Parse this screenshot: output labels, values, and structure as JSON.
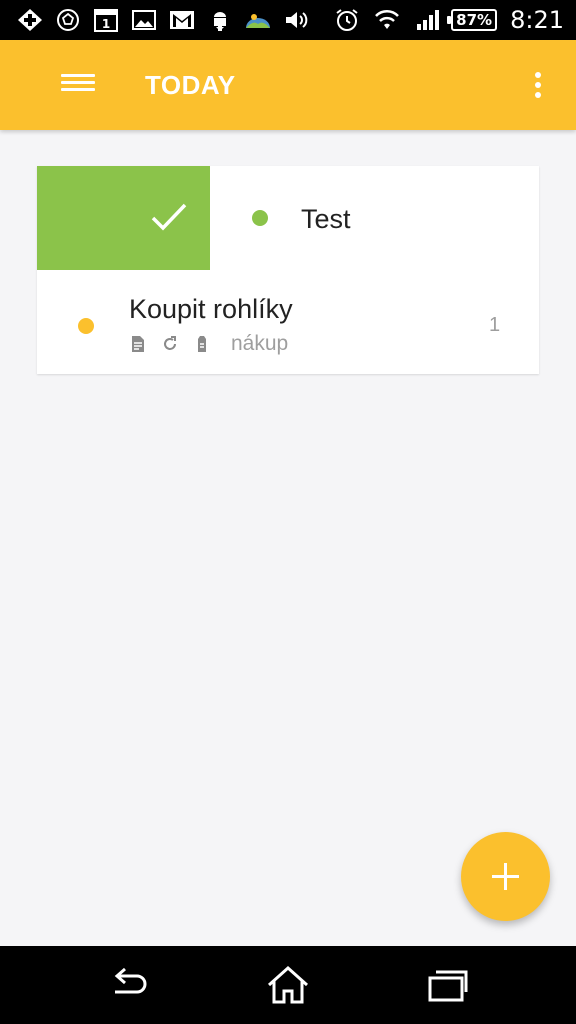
{
  "status_bar": {
    "notification_icons": [
      "plus-app-icon",
      "soccer-ball-icon",
      "calendar-icon",
      "gallery-icon",
      "gmail-icon",
      "android-icon",
      "landscape-icon",
      "volume-icon"
    ],
    "calendar_day": "1",
    "system_icons": [
      "alarm-icon",
      "wifi-icon",
      "signal-icon",
      "battery-icon"
    ],
    "battery": "87%",
    "time": "8:21"
  },
  "app_bar": {
    "title": "TODAY",
    "color": "#fbc02d"
  },
  "tasks": [
    {
      "title": "Test",
      "dot_color": "#8bc34a",
      "swiped_done": true,
      "done_color": "#8bc34a"
    },
    {
      "title": "Koupit rohlíky",
      "dot_color": "#fbc02d",
      "meta_icons": [
        "note-icon",
        "repeat-icon",
        "tag-icon"
      ],
      "tag": "nákup",
      "count": "1"
    }
  ],
  "fab": {
    "icon": "plus-icon",
    "color": "#fbc02d"
  },
  "nav_bar": {
    "buttons": [
      "back-icon",
      "home-icon",
      "recent-apps-icon"
    ]
  }
}
